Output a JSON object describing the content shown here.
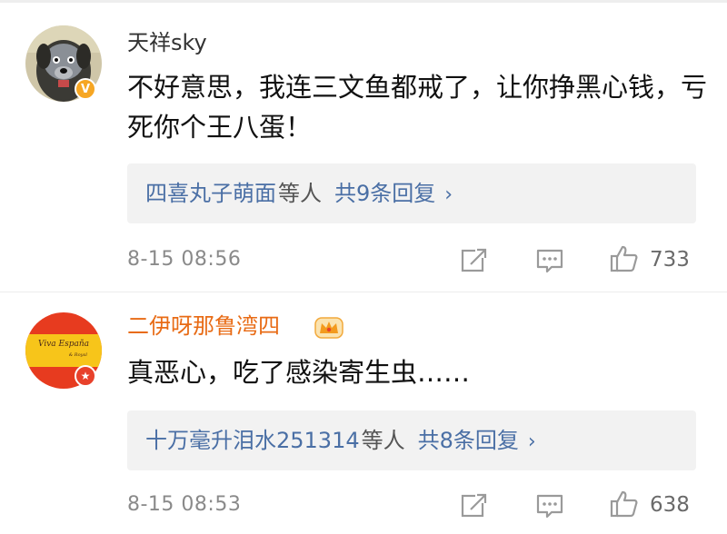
{
  "comments": [
    {
      "username": "天祥sky",
      "avatar_badge": "V",
      "text": "不好意思，我连三文鱼都戒了，让你挣黑心钱，亏死你个王八蛋！",
      "reply_names": "四喜丸子萌面",
      "reply_suffix": "等人",
      "reply_count": "共9条回复",
      "reply_chevron": "›",
      "timestamp": "8-15 08:56",
      "likes": "733"
    },
    {
      "username": "二伊呀那鲁湾四",
      "avatar_text": "Viva España",
      "avatar_subtext": "& Royal",
      "avatar_badge": "★",
      "text": "真恶心，吃了感染寄生虫……",
      "reply_names": "十万毫升泪水251314",
      "reply_suffix": "等人",
      "reply_count": "共8条回复",
      "reply_chevron": "›",
      "timestamp": "8-15 08:53",
      "likes": "638"
    }
  ],
  "icons": {
    "repost": "repost-icon",
    "comment": "comment-icon",
    "like": "like-icon",
    "verified": "verified-badge-icon",
    "crown": "crown-icon"
  },
  "colors": {
    "link_blue": "#4a6fa5",
    "vip_orange": "#e86b15",
    "reply_bg": "#f2f2f2",
    "muted": "#8a8a8a"
  }
}
